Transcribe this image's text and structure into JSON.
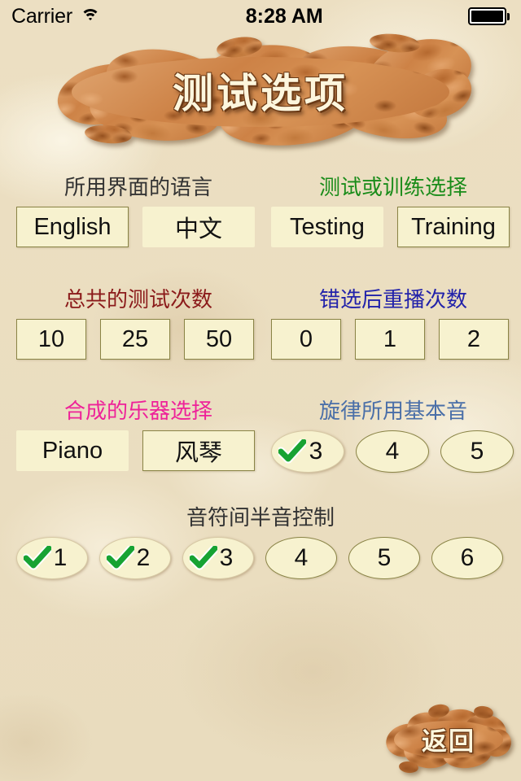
{
  "statusbar": {
    "carrier": "Carrier",
    "wifi_icon": "wifi-icon",
    "time": "8:28 AM",
    "battery_icon": "battery-full-icon"
  },
  "header": {
    "title": "测试选项"
  },
  "colors": {
    "background": "#ece0c3",
    "wood": "#d2884a",
    "button_face": "#f7f2cf",
    "button_border": "#8a8446",
    "check_green": "#17a333",
    "label_dark": "#333333",
    "label_green": "#1a8c1a",
    "label_red": "#8b1a1a",
    "label_blue": "#2222aa",
    "label_magenta": "#ee2299",
    "label_steel": "#4a6fa8",
    "title_text": "#fdf6dd"
  },
  "groups": [
    {
      "id": "language",
      "label": "所用界面的语言",
      "label_color": "#333333",
      "shape": "rect",
      "options": [
        {
          "label": "English",
          "selected": false,
          "checked": false
        },
        {
          "label": "中文",
          "selected": true,
          "checked": false
        }
      ]
    },
    {
      "id": "mode",
      "label": "测试或训练选择",
      "label_color": "#1a8c1a",
      "shape": "rect",
      "options": [
        {
          "label": "Testing",
          "selected": true,
          "checked": false
        },
        {
          "label": "Training",
          "selected": false,
          "checked": false
        }
      ]
    },
    {
      "id": "test-count",
      "label": "总共的测试次数",
      "label_color": "#8b1a1a",
      "shape": "rect",
      "options": [
        {
          "label": "10",
          "selected": false,
          "checked": false
        },
        {
          "label": "25",
          "selected": false,
          "checked": false
        },
        {
          "label": "50",
          "selected": false,
          "checked": false
        }
      ]
    },
    {
      "id": "replay-count",
      "label": "错选后重播次数",
      "label_color": "#2222aa",
      "shape": "rect",
      "options": [
        {
          "label": "0",
          "selected": false,
          "checked": false
        },
        {
          "label": "1",
          "selected": false,
          "checked": false
        },
        {
          "label": "2",
          "selected": false,
          "checked": false
        }
      ]
    },
    {
      "id": "instrument",
      "label": "合成的乐器选择",
      "label_color": "#ee2299",
      "shape": "rect",
      "options": [
        {
          "label": "Piano",
          "selected": true,
          "checked": false
        },
        {
          "label": "风琴",
          "selected": false,
          "checked": false
        }
      ]
    },
    {
      "id": "base-notes",
      "label": "旋律所用基本音",
      "label_color": "#4a6fa8",
      "shape": "oval",
      "options": [
        {
          "label": "3",
          "selected": true,
          "checked": true
        },
        {
          "label": "4",
          "selected": false,
          "checked": false
        },
        {
          "label": "5",
          "selected": false,
          "checked": false
        }
      ]
    },
    {
      "id": "semitone",
      "label": "音符间半音控制",
      "label_color": "#333333",
      "shape": "oval",
      "options": [
        {
          "label": "1",
          "selected": true,
          "checked": true
        },
        {
          "label": "2",
          "selected": true,
          "checked": true
        },
        {
          "label": "3",
          "selected": true,
          "checked": true
        },
        {
          "label": "4",
          "selected": false,
          "checked": false
        },
        {
          "label": "5",
          "selected": false,
          "checked": false
        },
        {
          "label": "6",
          "selected": false,
          "checked": false
        }
      ]
    }
  ],
  "back_button": {
    "label": "返回"
  }
}
